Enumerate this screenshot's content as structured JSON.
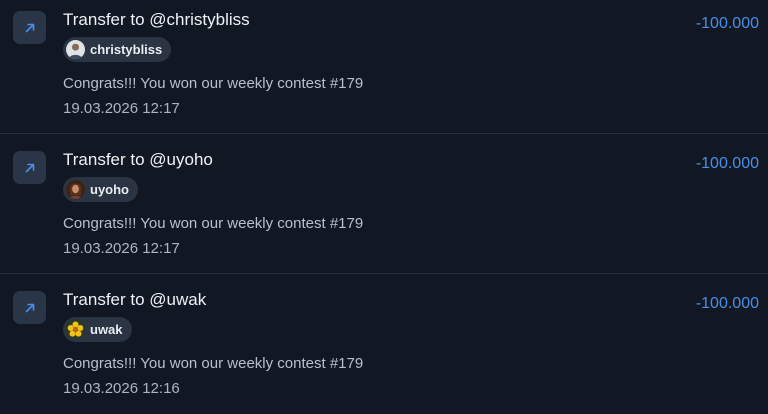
{
  "transactions": [
    {
      "title": "Transfer to @christybliss",
      "user": "christybliss",
      "avatar": "avatar-christybliss",
      "memo": "Congrats!!! You won our weekly contest #179",
      "date": "19.03.2026 12:17",
      "amount": "-100.000"
    },
    {
      "title": "Transfer to @uyoho",
      "user": "uyoho",
      "avatar": "avatar-uyoho",
      "memo": "Congrats!!! You won our weekly contest #179",
      "date": "19.03.2026 12:17",
      "amount": "-100.000"
    },
    {
      "title": "Transfer to @uwak",
      "user": "uwak",
      "avatar": "avatar-uwak",
      "memo": "Congrats!!! You won our weekly contest #179",
      "date": "19.03.2026 12:16",
      "amount": "-100.000"
    }
  ],
  "icons": {
    "transfer": "arrow-up-right-icon"
  },
  "colors": {
    "background": "#111823",
    "amount": "#4a8fe7",
    "icon_tile": "#2a3548",
    "chip": "#2a3443",
    "divider": "#26303d"
  }
}
